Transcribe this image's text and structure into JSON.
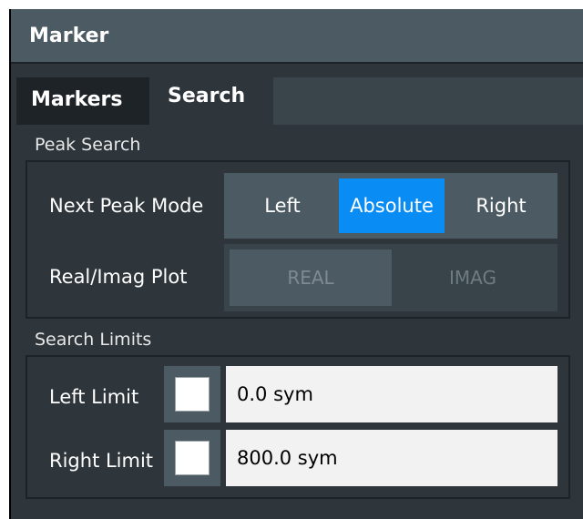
{
  "dialog": {
    "title": "Marker",
    "tabs": [
      {
        "label": "Markers",
        "active": false
      },
      {
        "label": "Search",
        "active": true
      }
    ]
  },
  "peak_search": {
    "group_label": "Peak Search",
    "next_peak_mode": {
      "label": "Next Peak Mode",
      "options": [
        "Left",
        "Absolute",
        "Right"
      ],
      "selected": "Absolute"
    },
    "real_imag_plot": {
      "label": "Real/Imag Plot",
      "options": [
        "REAL",
        "IMAG"
      ]
    }
  },
  "search_limits": {
    "group_label": "Search Limits",
    "left_limit": {
      "label": "Left Limit",
      "checked": false,
      "value": "0.0 sym"
    },
    "right_limit": {
      "label": "Right Limit",
      "checked": false,
      "value": "800.0 sym"
    }
  },
  "colors": {
    "selected_accent": "#0a8cf5",
    "panel_bg": "#2e363c",
    "titlebar_bg": "#4b5a63"
  }
}
